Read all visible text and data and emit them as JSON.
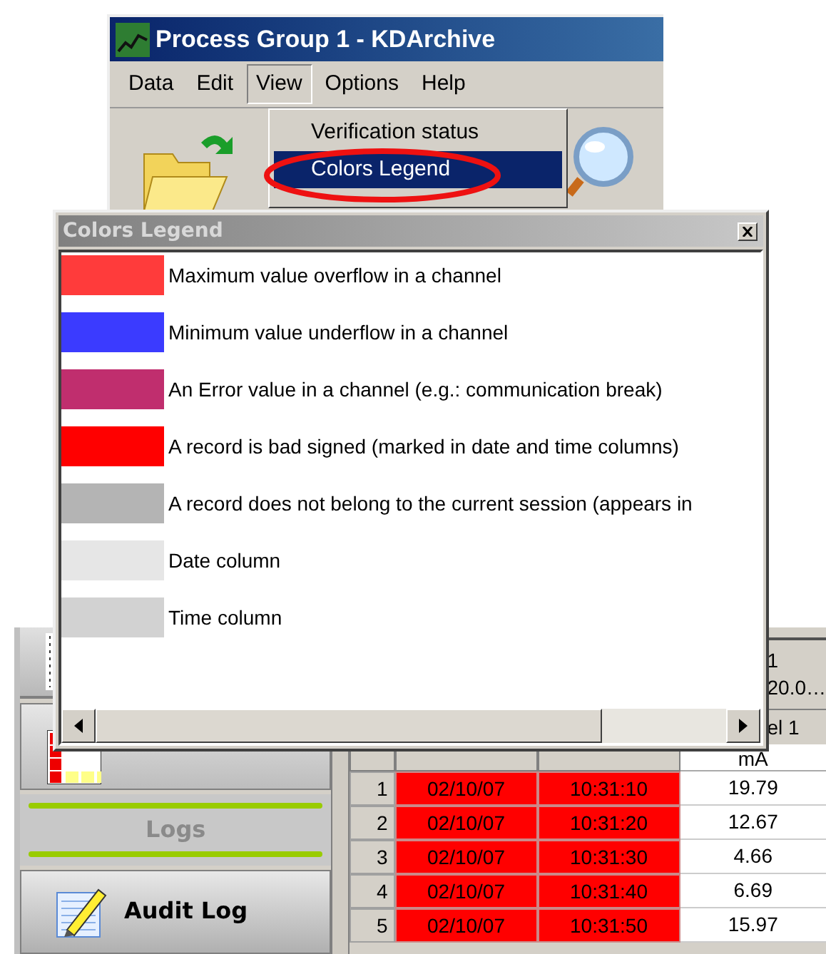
{
  "window": {
    "title": "Process Group 1 - KDArchive"
  },
  "menu_bar": [
    {
      "label": "Data",
      "selected": false
    },
    {
      "label": "Edit",
      "selected": false
    },
    {
      "label": "View",
      "selected": true
    },
    {
      "label": "Options",
      "selected": false
    },
    {
      "label": "Help",
      "selected": false
    }
  ],
  "view_menu": {
    "items": [
      {
        "label": "Verification status",
        "selected": false
      },
      {
        "label": "Colors Legend",
        "selected": true,
        "circled": true
      }
    ]
  },
  "legend": {
    "title": "Colors Legend",
    "items": [
      {
        "color": "#ff3b3b",
        "label": "Maximum value overflow in a channel"
      },
      {
        "color": "#3b3bff",
        "label": "Minimum value underflow in a channel"
      },
      {
        "color": "#c02e6e",
        "label": "An Error value in a channel (e.g.: communication break)"
      },
      {
        "color": "#ff0000",
        "label": "A record is bad signed (marked in date and time columns)"
      },
      {
        "color": "#b4b4b4",
        "label": "A record does not belong to the current session (appears in"
      },
      {
        "color": "#e6e6e6",
        "label": "Date column"
      },
      {
        "color": "#d2d2d2",
        "label": "Time column"
      }
    ]
  },
  "sidebar": {
    "section": "Logs",
    "items": [
      {
        "label": "Audit Log"
      }
    ]
  },
  "table": {
    "column_4_header": [
      "1",
      "20.0…",
      "el 1",
      "mA"
    ],
    "rows": [
      {
        "index": "1",
        "date": "02/10/07",
        "time": "10:31:10",
        "value": "19.79",
        "bad_signed": true
      },
      {
        "index": "2",
        "date": "02/10/07",
        "time": "10:31:20",
        "value": "12.67",
        "bad_signed": true
      },
      {
        "index": "3",
        "date": "02/10/07",
        "time": "10:31:30",
        "value": "4.66",
        "bad_signed": true
      },
      {
        "index": "4",
        "date": "02/10/07",
        "time": "10:31:40",
        "value": "6.69",
        "bad_signed": true
      },
      {
        "index": "5",
        "date": "02/10/07",
        "time": "10:31:50",
        "value": "15.97",
        "bad_signed": true
      }
    ]
  }
}
